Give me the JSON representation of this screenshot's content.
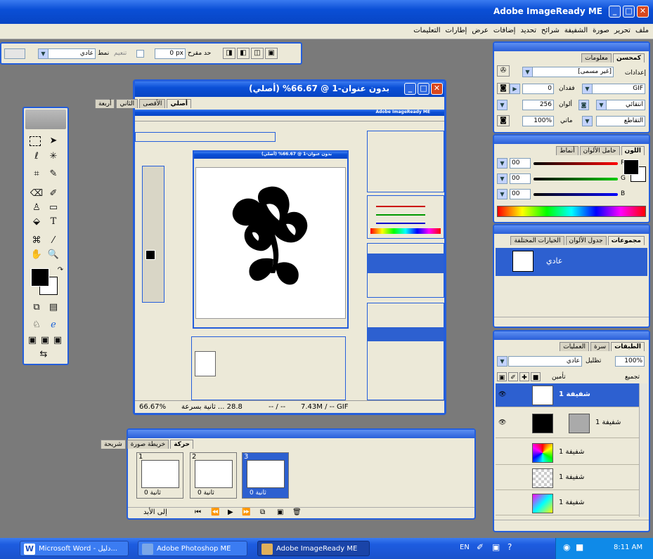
{
  "app": {
    "title": "Adobe ImageReady ME"
  },
  "menu": [
    "ملف",
    "تحرير",
    "صورة",
    "الشفيفة",
    "شرائح",
    "تحديد",
    "إضافات",
    "عرض",
    "إطارات",
    "التعليمات"
  ],
  "options_bar": {
    "size_value": "0 px",
    "style_value": "عادي",
    "size_label": "حد مقرح",
    "feather_label": "تنعيم",
    "style_label": "نمط"
  },
  "doc": {
    "title": "بدون عنوان-1 @ 66.67% (أصلي)",
    "tabs": [
      "أصلي",
      "الأقصى",
      "الثاني",
      "أربعة"
    ],
    "status": {
      "zoom": "66.67%",
      "speed": "28.8 ... ثانية بسرعة",
      "time": "-- / --",
      "size": "7.43M / -- GIF"
    }
  },
  "inner_doc": {
    "title": "بدون عنوان-1 @ 66.67% (أصلي)",
    "app_title": "Adobe ImageReady ME"
  },
  "optimize_panel": {
    "tabs": [
      "كمحسن",
      "معلومات"
    ],
    "settings_label": "إعدادات",
    "settings_value": "[غير مسمى]",
    "format": "GIF",
    "lossy_label": "فقدان",
    "lossy_value": "0",
    "colors_label": "ألوان",
    "colors_value": "256",
    "dither_label": "التقاطع",
    "dither_value": "100%",
    "matte_label": "ماتي",
    "palette": "انتقائي"
  },
  "color_panel": {
    "tabs": [
      "اللون",
      "حامل الألوان",
      "أنماط"
    ],
    "r_value": "00",
    "g_value": "00",
    "b_value": "00",
    "r_label": "R",
    "g_label": "G",
    "b_label": "B"
  },
  "styles_panel": {
    "tabs": [
      "مجموعات",
      "جدول الألوان",
      "الخيارات المختلفة"
    ],
    "item": "عادي"
  },
  "layers_panel": {
    "tabs": [
      "الطبقات",
      "سرة",
      "العمليات"
    ],
    "blend": "عادي",
    "opacity_label": "تظليل",
    "opacity_value": "100%",
    "lock_label": "تجميع",
    "unify_label": "تأمين",
    "layers": [
      "شفيفة 1",
      "شفيفة 1",
      "شفيفة 1",
      "شفيفة 1",
      "شفيفة 1"
    ]
  },
  "animation_panel": {
    "tabs": [
      "حركة",
      "خريطة صورة",
      "شريحة"
    ],
    "frames": [
      {
        "num": "1",
        "delay": "0 ثانية"
      },
      {
        "num": "2",
        "delay": "0 ثانية"
      },
      {
        "num": "3",
        "delay": "0 ثانية"
      }
    ],
    "loop": "إلى الأبد"
  },
  "taskbar": {
    "items": [
      "Microsoft Word - دليل...",
      "Adobe Photoshop ME",
      "Adobe ImageReady ME"
    ],
    "lang": "EN",
    "time": "8:11 AM"
  },
  "colors": {
    "xp_blue": "#245edb",
    "panel_bg": "#ece9d8",
    "desktop": "#7a7a7a"
  }
}
